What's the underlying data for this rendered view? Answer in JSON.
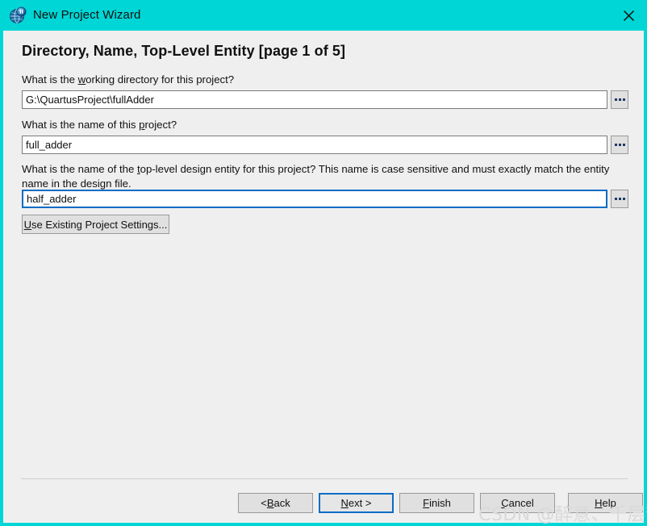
{
  "window": {
    "title": "New Project Wizard",
    "icon": "quartus-logo-icon",
    "close_label": "×",
    "titlebar_color": "#00d6d6",
    "client_background": "#efefef"
  },
  "page": {
    "heading": "Directory, Name, Top-Level Entity [page 1 of 5]"
  },
  "fields": {
    "directory": {
      "prompt_before": "What is the ",
      "prompt_accel": "w",
      "prompt_after": "orking directory for this project?",
      "value": "G:\\QuartusProject\\fullAdder",
      "placeholder": "",
      "browse_label": "...",
      "focused": false
    },
    "name": {
      "prompt_before": "What is the name of this ",
      "prompt_accel": "p",
      "prompt_after": "roject?",
      "value": "full_adder",
      "placeholder": "",
      "browse_label": "...",
      "focused": false
    },
    "entity": {
      "prompt_before": "What is the name of the ",
      "prompt_accel": "t",
      "prompt_after": "op-level design entity for this project? This name is case sensitive and must exactly match the entity name in the design file.",
      "value": "half_adder",
      "placeholder": "",
      "browse_label": "...",
      "focused": true
    }
  },
  "use_existing": {
    "accel": "U",
    "rest": "se Existing Project Settings..."
  },
  "footer": {
    "buttons": [
      {
        "name": "back",
        "prefix": "< ",
        "accel": "B",
        "suffix": "ack",
        "default": false
      },
      {
        "name": "next",
        "prefix": "",
        "accel": "N",
        "suffix": "ext >",
        "default": true
      },
      {
        "name": "finish",
        "prefix": "",
        "accel": "F",
        "suffix": "inish",
        "default": false
      },
      {
        "name": "cancel",
        "prefix": "",
        "accel": "C",
        "suffix": "ancel",
        "default": false
      },
      {
        "name": "help",
        "prefix": "",
        "accel": "H",
        "suffix": "elp",
        "default": false
      }
    ]
  },
  "watermark": {
    "text": "CSDN @醉意、千层梦"
  },
  "colors": {
    "accent": "#00d6d6",
    "focus_border": "#0a6cc4",
    "button_face": "#e0e0e0",
    "field_border": "#7a7a7a"
  }
}
